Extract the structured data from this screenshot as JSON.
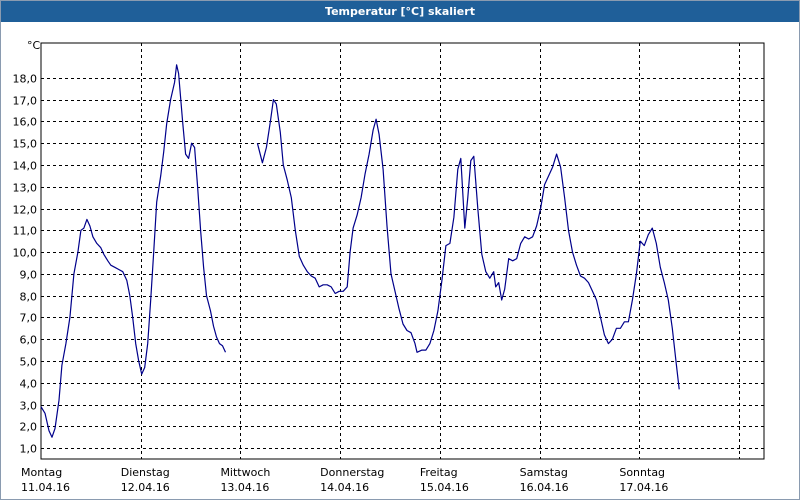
{
  "window": {
    "title": "Temperatur [°C] skaliert",
    "title_bg": "#1f5f99"
  },
  "chart_data": {
    "type": "line",
    "title": "Temperatur [°C] skaliert",
    "yunit": "°C",
    "ylim": [
      0.5,
      19.6
    ],
    "yticks": [
      1,
      2,
      3,
      4,
      5,
      6,
      7,
      8,
      9,
      10,
      11,
      12,
      13,
      14,
      15,
      16,
      17,
      18
    ],
    "ytick_labels": [
      "1,0",
      "2,0",
      "3,0",
      "4,0",
      "5,0",
      "6,0",
      "7,0",
      "8,0",
      "9,0",
      "10,0",
      "11,0",
      "12,0",
      "13,0",
      "14,0",
      "15,0",
      "16,0",
      "17,0",
      "18,0"
    ],
    "xlim_days": [
      0,
      7.25
    ],
    "grid": true,
    "legend": "none",
    "line_color": "#00008b",
    "day_labels": [
      {
        "day": "Montag",
        "date": "11.04.16"
      },
      {
        "day": "Dienstag",
        "date": "12.04.16"
      },
      {
        "day": "Mittwoch",
        "date": "13.04.16"
      },
      {
        "day": "Donnerstag",
        "date": "14.04.16"
      },
      {
        "day": "Freitag",
        "date": "15.04.16"
      },
      {
        "day": "Samstag",
        "date": "16.04.16"
      },
      {
        "day": "Sonntag",
        "date": "17.04.16"
      }
    ],
    "series": [
      {
        "segments": [
          [
            [
              0,
              2.9
            ],
            [
              0.04,
              2.6
            ],
            [
              0.08,
              1.8
            ],
            [
              0.11,
              1.5
            ],
            [
              0.14,
              1.9
            ],
            [
              0.18,
              3.2
            ],
            [
              0.21,
              4.8
            ],
            [
              0.25,
              5.8
            ],
            [
              0.29,
              7
            ],
            [
              0.33,
              9
            ],
            [
              0.37,
              10
            ],
            [
              0.4,
              11
            ],
            [
              0.43,
              11.1
            ],
            [
              0.46,
              11.5
            ],
            [
              0.49,
              11.2
            ],
            [
              0.52,
              10.7
            ],
            [
              0.56,
              10.4
            ],
            [
              0.6,
              10.2
            ],
            [
              0.63,
              9.9
            ],
            [
              0.67,
              9.6
            ],
            [
              0.7,
              9.4
            ],
            [
              0.74,
              9.3
            ],
            [
              0.78,
              9.2
            ],
            [
              0.82,
              9.1
            ],
            [
              0.86,
              8.7
            ],
            [
              0.89,
              8
            ],
            [
              0.92,
              7
            ],
            [
              0.95,
              5.8
            ],
            [
              0.98,
              5
            ],
            [
              1.01,
              4.4
            ],
            [
              1.04,
              4.7
            ],
            [
              1.07,
              5.8
            ],
            [
              1.1,
              7.8
            ],
            [
              1.13,
              10
            ],
            [
              1.16,
              12.3
            ],
            [
              1.2,
              13.5
            ],
            [
              1.23,
              14.6
            ],
            [
              1.26,
              15.9
            ],
            [
              1.3,
              17
            ],
            [
              1.34,
              17.8
            ],
            [
              1.36,
              18.6
            ],
            [
              1.38,
              18.2
            ],
            [
              1.42,
              16
            ],
            [
              1.45,
              14.5
            ],
            [
              1.48,
              14.3
            ],
            [
              1.51,
              15
            ],
            [
              1.54,
              14.8
            ],
            [
              1.57,
              13
            ],
            [
              1.6,
              11
            ],
            [
              1.63,
              9.3
            ],
            [
              1.66,
              8
            ],
            [
              1.7,
              7.3
            ],
            [
              1.73,
              6.6
            ],
            [
              1.76,
              6.1
            ],
            [
              1.79,
              5.8
            ],
            [
              1.82,
              5.7
            ],
            [
              1.85,
              5.4
            ]
          ],
          [
            [
              2.17,
              15
            ],
            [
              2.22,
              14.1
            ],
            [
              2.26,
              14.8
            ],
            [
              2.3,
              16
            ],
            [
              2.33,
              17
            ],
            [
              2.36,
              16.8
            ],
            [
              2.4,
              15.5
            ],
            [
              2.43,
              14
            ],
            [
              2.47,
              13.3
            ],
            [
              2.51,
              12.5
            ],
            [
              2.55,
              11
            ],
            [
              2.59,
              9.8
            ],
            [
              2.63,
              9.4
            ],
            [
              2.67,
              9.1
            ],
            [
              2.71,
              8.9
            ],
            [
              2.75,
              8.8
            ],
            [
              2.79,
              8.4
            ],
            [
              2.83,
              8.5
            ],
            [
              2.87,
              8.5
            ],
            [
              2.91,
              8.4
            ],
            [
              2.95,
              8.1
            ],
            [
              2.99,
              8.2
            ],
            [
              3.03,
              8.2
            ],
            [
              3.07,
              8.4
            ],
            [
              3.1,
              10
            ],
            [
              3.13,
              11.1
            ],
            [
              3.17,
              11.7
            ],
            [
              3.21,
              12.5
            ],
            [
              3.25,
              13.6
            ],
            [
              3.29,
              14.5
            ],
            [
              3.33,
              15.6
            ],
            [
              3.36,
              16.1
            ],
            [
              3.39,
              15.4
            ],
            [
              3.43,
              13.8
            ],
            [
              3.47,
              11.2
            ],
            [
              3.51,
              9
            ],
            [
              3.55,
              8.2
            ],
            [
              3.59,
              7.4
            ],
            [
              3.63,
              6.7
            ],
            [
              3.67,
              6.4
            ],
            [
              3.71,
              6.3
            ],
            [
              3.75,
              5.8
            ],
            [
              3.77,
              5.4
            ],
            [
              3.82,
              5.5
            ],
            [
              3.86,
              5.5
            ],
            [
              3.9,
              5.8
            ],
            [
              3.94,
              6.4
            ],
            [
              3.98,
              7.3
            ],
            [
              4.02,
              8.7
            ],
            [
              4.06,
              10.3
            ],
            [
              4.1,
              10.4
            ],
            [
              4.14,
              11.6
            ],
            [
              4.18,
              13.8
            ],
            [
              4.21,
              14.3
            ],
            [
              4.25,
              11.1
            ],
            [
              4.28,
              12.5
            ],
            [
              4.31,
              14.2
            ],
            [
              4.34,
              14.4
            ],
            [
              4.38,
              12
            ],
            [
              4.42,
              9.9
            ],
            [
              4.46,
              9.1
            ],
            [
              4.5,
              8.8
            ],
            [
              4.54,
              9.1
            ],
            [
              4.56,
              8.4
            ],
            [
              4.59,
              8.6
            ],
            [
              4.62,
              7.8
            ],
            [
              4.65,
              8.3
            ],
            [
              4.69,
              9.7
            ],
            [
              4.73,
              9.6
            ],
            [
              4.77,
              9.7
            ],
            [
              4.81,
              10.4
            ],
            [
              4.85,
              10.7
            ],
            [
              4.89,
              10.6
            ],
            [
              4.93,
              10.7
            ],
            [
              4.97,
              11.2
            ],
            [
              5.01,
              12
            ],
            [
              5.05,
              13.1
            ],
            [
              5.09,
              13.5
            ],
            [
              5.13,
              13.9
            ],
            [
              5.17,
              14.5
            ],
            [
              5.21,
              13.9
            ],
            [
              5.25,
              12.5
            ],
            [
              5.29,
              11
            ],
            [
              5.33,
              10
            ],
            [
              5.37,
              9.4
            ],
            [
              5.41,
              8.9
            ],
            [
              5.45,
              8.8
            ],
            [
              5.49,
              8.6
            ],
            [
              5.53,
              8.2
            ],
            [
              5.57,
              7.8
            ],
            [
              5.61,
              7
            ],
            [
              5.65,
              6.2
            ],
            [
              5.69,
              5.8
            ],
            [
              5.73,
              6
            ],
            [
              5.77,
              6.5
            ],
            [
              5.81,
              6.5
            ],
            [
              5.85,
              6.8
            ],
            [
              5.89,
              6.8
            ],
            [
              5.93,
              7.8
            ],
            [
              5.97,
              9
            ],
            [
              6.01,
              10.5
            ],
            [
              6.05,
              10.3
            ],
            [
              6.09,
              10.8
            ],
            [
              6.13,
              11.1
            ],
            [
              6.17,
              10.4
            ],
            [
              6.21,
              9.3
            ],
            [
              6.25,
              8.6
            ],
            [
              6.29,
              7.8
            ],
            [
              6.33,
              6.5
            ],
            [
              6.37,
              4.9
            ],
            [
              6.4,
              3.7
            ]
          ]
        ]
      }
    ]
  }
}
